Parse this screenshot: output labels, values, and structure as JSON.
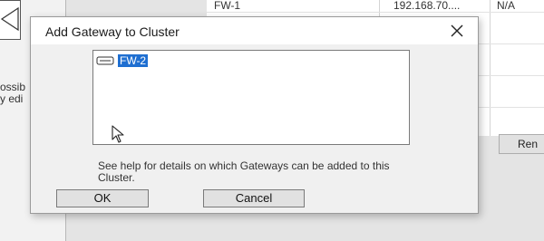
{
  "background": {
    "left_panel_text": "ossib\ny edi",
    "table_row": {
      "name": "FW-1",
      "ip": "192.168.70....",
      "extra": "N/A"
    },
    "remove_button_label": "Ren"
  },
  "dialog": {
    "title": "Add Gateway to Cluster",
    "gateway_list": [
      {
        "label": "FW-2",
        "icon": "gateway-device-icon",
        "selected": true
      }
    ],
    "help_text": "See help for details on which Gateways can be added to this Cluster.",
    "ok_label": "OK",
    "cancel_label": "Cancel"
  },
  "colors": {
    "selection": "#1f6fd1",
    "dialog_bg": "#f0f0f0",
    "titlebar_bg": "#ffffff"
  }
}
